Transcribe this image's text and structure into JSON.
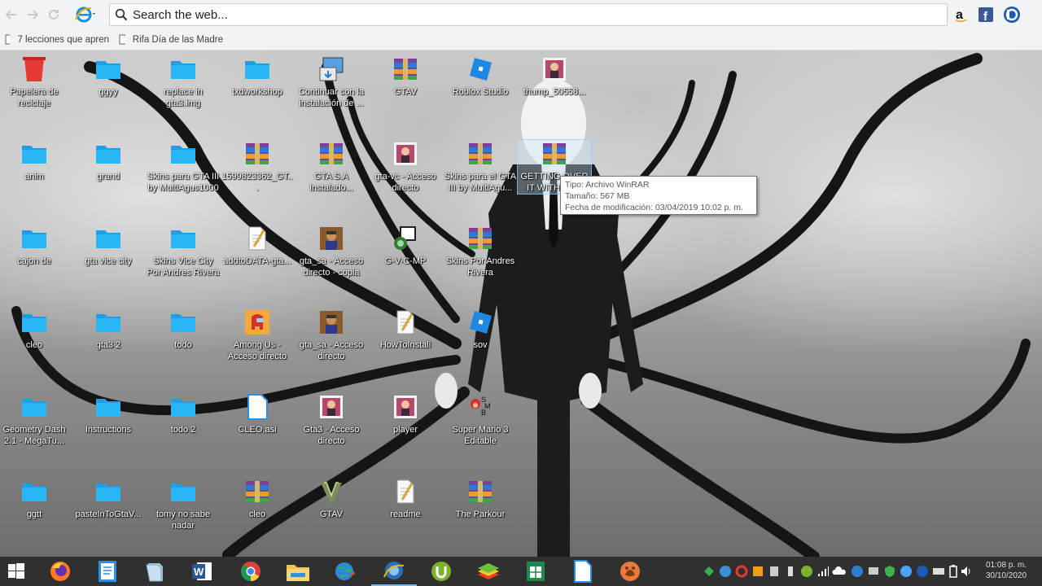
{
  "browser": {
    "search_placeholder": "Search the web...",
    "search_value": "",
    "extensions": [
      "amazon-icon",
      "facebook-icon",
      "extension-d-icon"
    ],
    "bookmarks": [
      {
        "label": "7 lecciones que apren"
      },
      {
        "label": "Rifa Día de las Madre"
      }
    ]
  },
  "desktop": {
    "icons": [
      {
        "label": "Papelera de reciclaje",
        "type": "recycle-bin"
      },
      {
        "label": "ggyy",
        "type": "folder"
      },
      {
        "label": "replace in gta3.img",
        "type": "folder"
      },
      {
        "label": "txdworkshop",
        "type": "folder"
      },
      {
        "label": "Continuar con la instalación de ...",
        "type": "installer"
      },
      {
        "label": "GTAV",
        "type": "winrar"
      },
      {
        "label": "Roblox Studio",
        "type": "roblox"
      },
      {
        "label": "thump_50558...",
        "type": "image"
      },
      {
        "label": "anim",
        "type": "folder"
      },
      {
        "label": "grand",
        "type": "folder"
      },
      {
        "label": "Skins para GTA III by MultiAgus1000",
        "type": "folder"
      },
      {
        "label": "1599823362_GT...",
        "type": "winrar"
      },
      {
        "label": "GTA S.A Instalado...",
        "type": "winrar"
      },
      {
        "label": "gta-vc - Acceso directo",
        "type": "image"
      },
      {
        "label": "Skins para el GTA III by MultiAgu...",
        "type": "winrar"
      },
      {
        "label": "GETTING OVER IT WITH BE... FODD... Tutori... bautista",
        "type": "winrar"
      },
      {
        "label": "cajon de",
        "type": "folder"
      },
      {
        "label": "gta vice city",
        "type": "folder"
      },
      {
        "label": "Skins Vice City Por Andres Rivera",
        "type": "folder"
      },
      {
        "label": "addtoDATA-gta...",
        "type": "textfile"
      },
      {
        "label": "gta_sa - Acceso directo - copia",
        "type": "gta-sa"
      },
      {
        "label": "G-V-C-MP",
        "type": "app"
      },
      {
        "label": "Skins Por Andres Rivera",
        "type": "winrar"
      },
      {
        "label": "cleo",
        "type": "folder"
      },
      {
        "label": "gta3 2",
        "type": "folder"
      },
      {
        "label": "todo",
        "type": "folder"
      },
      {
        "label": "Among Us - Acceso directo",
        "type": "among-us"
      },
      {
        "label": "gta_sa - Acceso directo",
        "type": "gta-sa"
      },
      {
        "label": "HowToInstall",
        "type": "textfile"
      },
      {
        "label": "sov",
        "type": "roblox"
      },
      {
        "label": "Geometry Dash 2.1 - MegaTu...",
        "type": "folder"
      },
      {
        "label": "Instructions",
        "type": "folder"
      },
      {
        "label": "todo 2",
        "type": "folder"
      },
      {
        "label": "CLEO.asi",
        "type": "file"
      },
      {
        "label": "Gta3 - Acceso directo",
        "type": "image"
      },
      {
        "label": "player",
        "type": "image"
      },
      {
        "label": "Super Mario 3 Editable",
        "type": "mario"
      },
      {
        "label": "ggtt",
        "type": "folder"
      },
      {
        "label": "pasteInToGtaV...",
        "type": "folder"
      },
      {
        "label": "tomy no sabe nadar",
        "type": "folder"
      },
      {
        "label": "cleo",
        "type": "winrar"
      },
      {
        "label": "GTAV",
        "type": "gtav"
      },
      {
        "label": "readme",
        "type": "textfile"
      },
      {
        "label": "The Parkour",
        "type": "winrar"
      }
    ],
    "tooltip": {
      "line1": "Tipo: Archivo WinRAR",
      "line2": "Tamaño: 567 MB",
      "line3": "Fecha de modificación: 03/04/2019 10:02 p. m."
    }
  },
  "taskbar": {
    "apps": [
      "start-icon",
      "firefox-icon",
      "notepad-icon",
      "files-icon",
      "word-icon",
      "chrome-icon",
      "file-explorer-icon",
      "globe-icon",
      "ie-icon",
      "utorrent-icon",
      "bluestacks-icon",
      "excel-icon",
      "document-icon",
      "paw-icon"
    ],
    "clock": {
      "time": "01:08 p. m.",
      "date": "30/10/2020"
    }
  }
}
